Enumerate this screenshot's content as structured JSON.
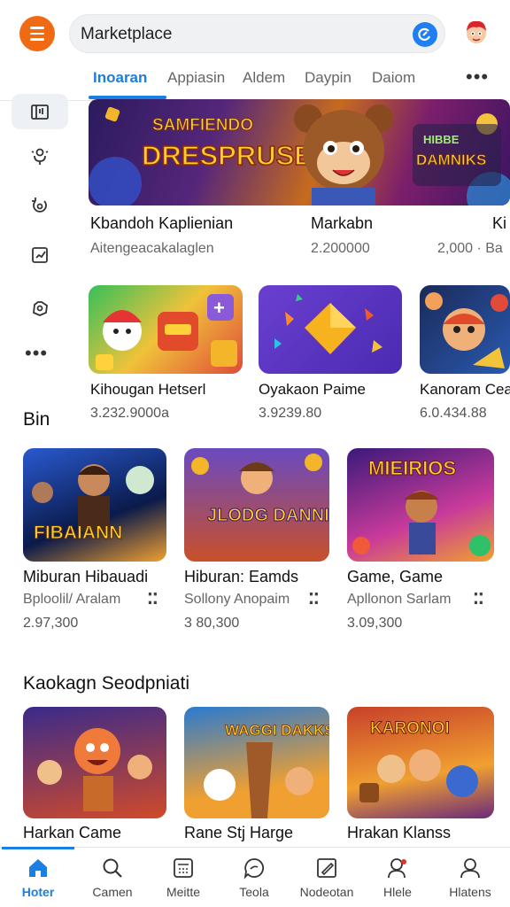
{
  "header": {
    "search_text": "Marketplace",
    "icons": {
      "menu": "menu-icon",
      "search": "search-icon",
      "avatar": "user-avatar"
    },
    "accent_color": "#1a7fe0",
    "menu_color": "#f06a13"
  },
  "tabs": [
    {
      "label": "Inoaran"
    },
    {
      "label": "Appiasin"
    },
    {
      "label": "Aldem"
    },
    {
      "label": "Daypin"
    },
    {
      "label": "Daiom"
    }
  ],
  "rail": {
    "items": [
      "library-icon",
      "podcast-icon",
      "refresh-icon",
      "checklist-icon",
      "settings-icon"
    ]
  },
  "hero": {
    "left_text": "DRESPRUSE",
    "left_small": "SAMFIENDO",
    "right_text": "DAMNIKS",
    "right_small": "HIBBE"
  },
  "featured": [
    {
      "title": "Kbandoh Kaplienian",
      "subtitle": "Aitengeacakalaglen"
    },
    {
      "title": "Markabn",
      "subtitle": "2.200000"
    },
    {
      "title": "Ki",
      "subtitle": "2,000 · Ba"
    }
  ],
  "row_two": [
    {
      "title": "Kihougan Hetserl",
      "price": "3.232.9000a"
    },
    {
      "title": "Oyakaon Paime",
      "price": "3.9239.80"
    },
    {
      "title": "Kanoram Cea",
      "price": "6.0.434.88"
    }
  ],
  "section_bin": {
    "title": "Bin",
    "items": [
      {
        "title": "Miburan Hibauadi",
        "subtitle": "Bploolil/ Aralam",
        "price": "2.97,300",
        "art_text": "FIBAIANN"
      },
      {
        "title": "Hiburan: Eamds",
        "subtitle": "Sollony Anopaim",
        "price": "3 80,300",
        "art_text": "JLODG DANNIKS"
      },
      {
        "title": "Game, Game",
        "subtitle": "Apllonon Sarlam",
        "price": "3.09,300",
        "art_text": "MIEIRIOS"
      }
    ]
  },
  "section_two": {
    "title": "Kaokagn Seodpniati",
    "items": [
      {
        "title": "Harkan Came",
        "art_text": ""
      },
      {
        "title": "Rane Stj Harge",
        "art_text": "WAGGI DAKKS"
      },
      {
        "title": "Hrakan Klanss",
        "art_text": "KARONOI"
      }
    ]
  },
  "bottom_nav": [
    {
      "label": "Hoter",
      "icon": "home-icon",
      "active": true
    },
    {
      "label": "Camen",
      "icon": "search-icon"
    },
    {
      "label": "Meitte",
      "icon": "calculator-icon"
    },
    {
      "label": "Teola",
      "icon": "chat-icon"
    },
    {
      "label": "Nodeotan",
      "icon": "edit-icon"
    },
    {
      "label": "Hlele",
      "icon": "user-alert-icon"
    },
    {
      "label": "Hlatens",
      "icon": "profile-icon"
    }
  ]
}
